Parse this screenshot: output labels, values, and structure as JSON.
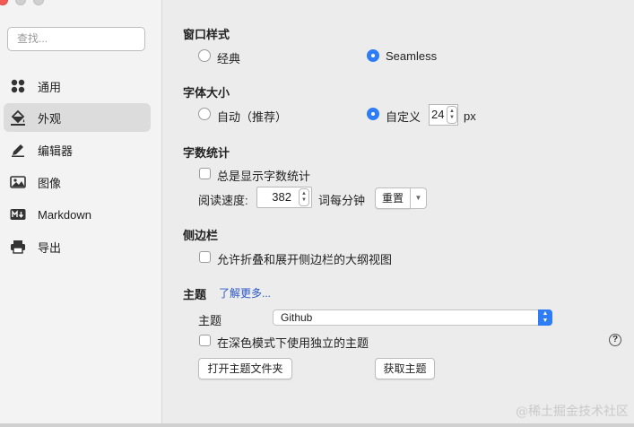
{
  "sidebar": {
    "search_placeholder": "查找...",
    "items": [
      {
        "label": "通用",
        "icon": "grid-icon"
      },
      {
        "label": "外观",
        "icon": "paint-bucket-icon",
        "active": true
      },
      {
        "label": "编辑器",
        "icon": "pencil-icon"
      },
      {
        "label": "图像",
        "icon": "image-icon"
      },
      {
        "label": "Markdown",
        "icon": "markdown-icon"
      },
      {
        "label": "导出",
        "icon": "printer-icon"
      }
    ]
  },
  "window_style": {
    "title": "窗口样式",
    "option_classic": "经典",
    "option_seamless": "Seamless",
    "selected": "Seamless"
  },
  "font_size": {
    "title": "字体大小",
    "option_auto": "自动（推荐）",
    "option_custom": "自定义",
    "selected": "自定义",
    "value": "24",
    "unit": "px"
  },
  "word_count": {
    "title": "字数统计",
    "always_show_label": "总是显示字数统计",
    "always_show_checked": false,
    "speed_label": "阅读速度:",
    "speed_value": "382",
    "speed_unit": "词每分钟",
    "reset_label": "重置"
  },
  "sidebar_section": {
    "title": "侧边栏",
    "allow_fold_label": "允许折叠和展开侧边栏的大纲视图",
    "allow_fold_checked": false
  },
  "theme": {
    "title": "主题",
    "learn_more": "了解更多...",
    "theme_label": "主题",
    "theme_value": "Github",
    "dark_mode_label": "在深色模式下使用独立的主题",
    "dark_mode_checked": false,
    "open_folder_label": "打开主题文件夹",
    "get_themes_label": "获取主题",
    "help_glyph": "?"
  },
  "watermark": "@稀土掘金技术社区",
  "colors": {
    "accent": "#2e7cf6",
    "link": "#2a57c8",
    "close_button": "#f25b55"
  }
}
